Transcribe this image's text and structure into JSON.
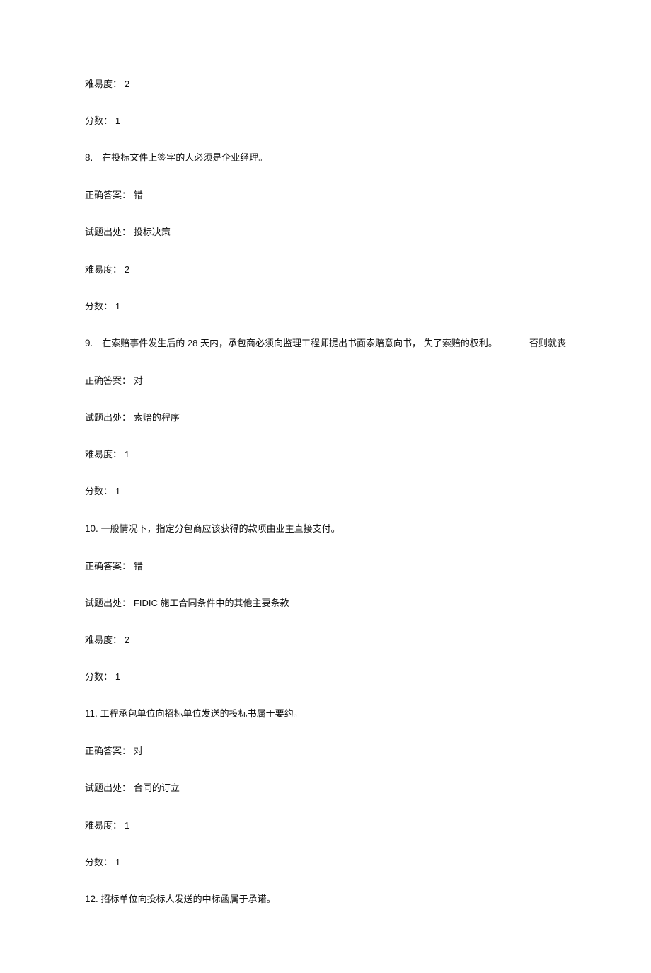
{
  "labels": {
    "difficulty": "难易度：",
    "score": "分数：",
    "correct_answer": "正确答案：",
    "source": "试题出处："
  },
  "q7_tail": {
    "difficulty": "2",
    "score": "1"
  },
  "q8": {
    "num": "8.",
    "text": "在投标文件上签字的人必须是企业经理。",
    "answer": "错",
    "source": "投标决策",
    "difficulty": "2",
    "score": "1"
  },
  "q9": {
    "num": "9.",
    "text_a": "在索赔事件发生后的",
    "text_b_num": "28",
    "text_c": "天内，承包商必须向监理工程师提出书面索赔意向书，",
    "text_d": "失了索赔的权利。",
    "text_right": "否则就丧",
    "answer": "对",
    "source": "索赔的程序",
    "difficulty": "1",
    "score": "1"
  },
  "q10": {
    "num": "10.",
    "text": "一般情况下，指定分包商应该获得的款项由业主直接支付。",
    "answer": "错",
    "source_a": "FIDIC",
    "source_b": "施工合同条件中的其他主要条款",
    "difficulty": "2",
    "score": "1"
  },
  "q11": {
    "num": "11.",
    "text": "工程承包单位向招标单位发送的投标书属于要约。",
    "answer": "对",
    "source": "合同的订立",
    "difficulty": "1",
    "score": "1"
  },
  "q12": {
    "num": "12.",
    "text": "招标单位向投标人发送的中标函属于承诺。"
  }
}
